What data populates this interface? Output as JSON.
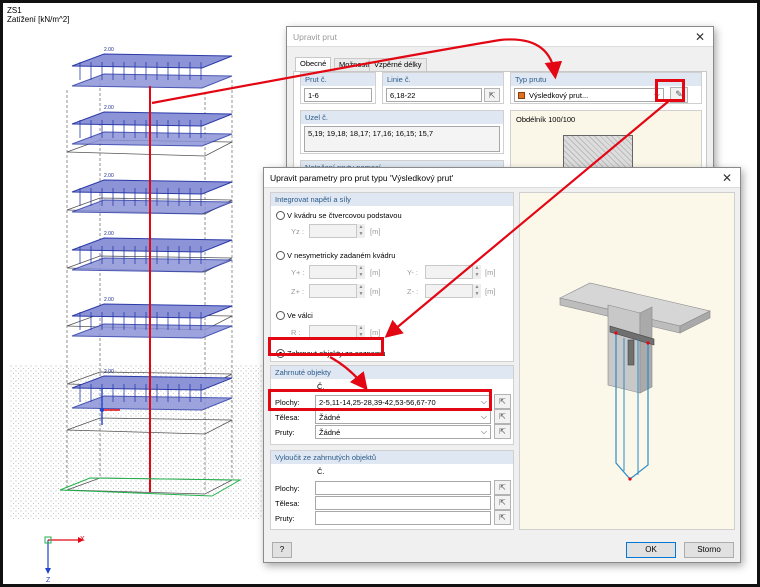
{
  "load_case": {
    "name": "ZS1",
    "unit_label": "Zatížení [kN/m^2]"
  },
  "load_value": "2.00",
  "axes": {
    "x": "X",
    "z": "Z"
  },
  "back_dialog": {
    "title": "Upravit prut",
    "tabs": [
      "Obecné",
      "Možnosti",
      "Vzpěrné délky"
    ],
    "member_no_label": "Prut č.",
    "member_no_value": "1-6",
    "line_no_label": "Linie č.",
    "line_no_value": "6,18-22",
    "member_type_label": "Typ prutu",
    "member_type_value": "Výsledkový prut...",
    "nodes_label": "Uzel č.",
    "nodes_value": "5,19; 19,18; 18,17; 17,16; 16,15; 15,7",
    "section_label": "Obdélník 100/100",
    "partial_label": "Natočení prutu pomocí"
  },
  "front_dialog": {
    "title": "Upravit parametry pro prut typu 'Výsledkový prut'",
    "integrate_header": "Integrovat napětí a síly",
    "opt_square": "V kvádru se čtvercovou podstavou",
    "yz_label": "Yz :",
    "opt_asym": "V nesymetricky zadaném kvádru",
    "y_plus": "Y+ :",
    "y_minus": "Y- :",
    "z_plus": "Z+ :",
    "z_minus": "Z- :",
    "opt_cyl": "Ve válci",
    "r_label": "R :",
    "unit_m": "[m]",
    "opt_list": "Zahrnout objekty ze seznamu",
    "included_header": "Zahrnuté objekty",
    "col_no": "Č.",
    "surfaces_label": "Plochy:",
    "surfaces_value": "2-5,11-14,25-28,39-42,53-56,67-70",
    "solids_label": "Tělesa:",
    "solids_value": "Žádné",
    "members_label": "Pruty:",
    "members_value": "Žádné",
    "excluded_header": "Vyloučit ze zahrnutých objektů",
    "ok": "OK",
    "cancel": "Storno"
  },
  "colors": {
    "highlight": "#e30613",
    "load": "#2b3aa8",
    "load_fill": "#8c93d6",
    "support": "#22b14c"
  }
}
